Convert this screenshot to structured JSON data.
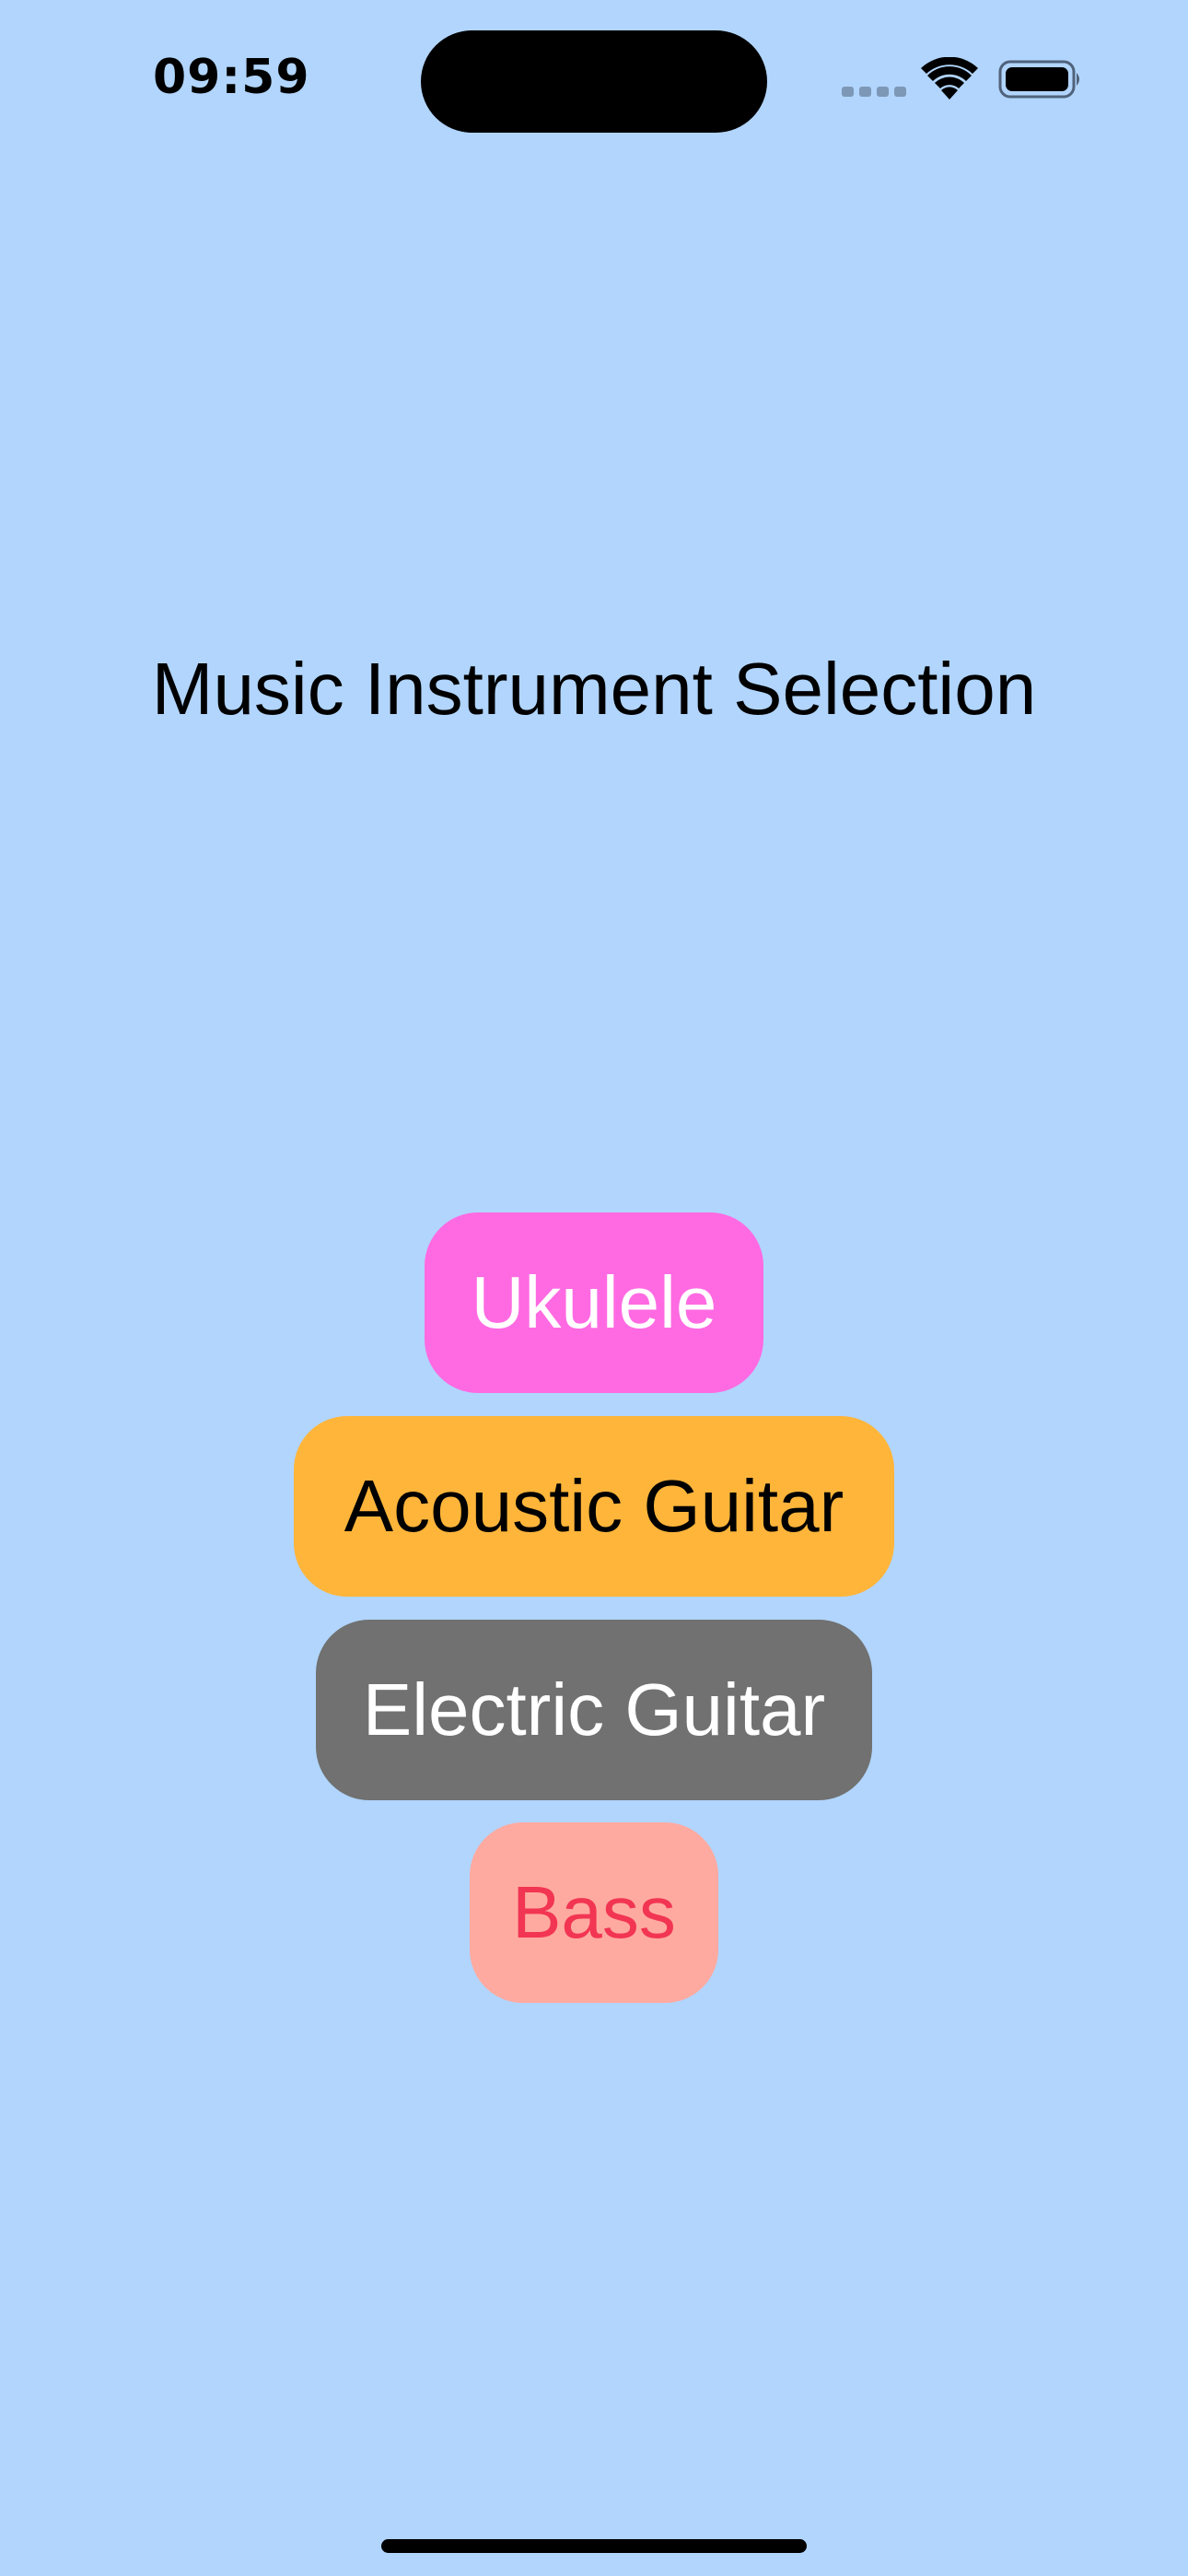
{
  "status_bar": {
    "time": "09:59",
    "icons": [
      "signal-icon",
      "wifi-icon",
      "battery-icon"
    ]
  },
  "title": "Music Instrument Selection",
  "instruments": [
    {
      "label": "Ukulele",
      "background": "#ff6ae2",
      "text_color": "#ffffff"
    },
    {
      "label": "Acoustic Guitar",
      "background": "#ffb53a",
      "text_color": "#000000"
    },
    {
      "label": "Electric Guitar",
      "background": "#707170",
      "text_color": "#ffffff"
    },
    {
      "label": "Bass",
      "background": "#ffaaa0",
      "text_color": "#f23553"
    }
  ],
  "colors": {
    "page_background": "#b1d5fd"
  }
}
